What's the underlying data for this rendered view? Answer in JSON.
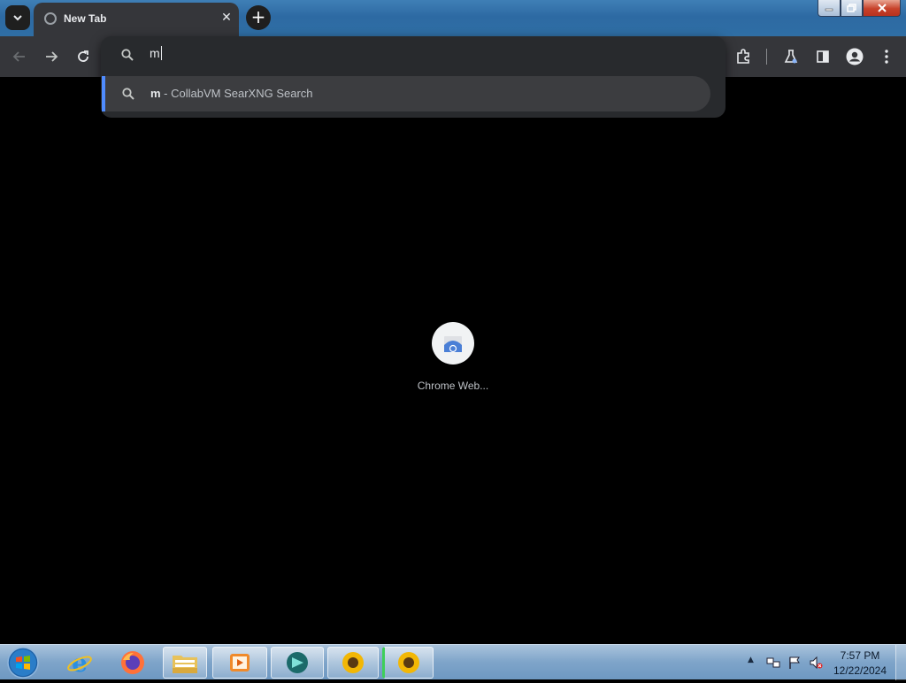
{
  "tab": {
    "title": "New Tab"
  },
  "omnibox": {
    "input_value": "m",
    "suggestion_query": "m",
    "suggestion_rest": " - CollabVM SearXNG Search"
  },
  "shortcut": {
    "label": "Chrome Web..."
  },
  "clock": {
    "time": "7:57 PM",
    "date": "12/22/2024"
  },
  "colors": {
    "accent": "#4f8cff",
    "toolbar": "#35363a",
    "popup": "#282a2d"
  },
  "taskbar_apps": [
    "internet-explorer-icon",
    "firefox-icon",
    "file-explorer-icon",
    "media-player-icon",
    "app-icon",
    "sunflower-window",
    "sunflower-window"
  ]
}
